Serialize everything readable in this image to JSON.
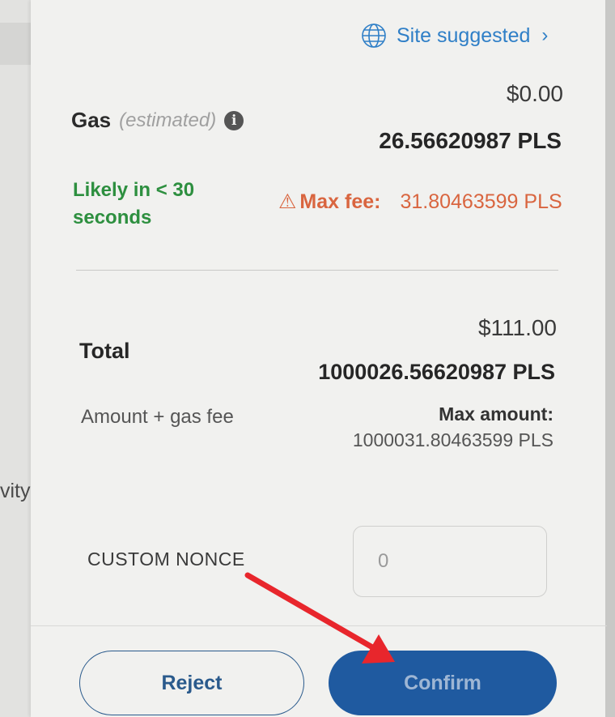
{
  "sidebar": {
    "partial_text": "vity"
  },
  "site_suggested": {
    "label": "Site suggested",
    "icon": "globe-icon",
    "chevron": "›"
  },
  "gas": {
    "title": "Gas",
    "estimated": "(estimated)",
    "info_icon": "i",
    "usd": "$0.00",
    "pls": "26.56620987 PLS",
    "likely": "Likely in < 30 seconds",
    "max_fee_warning_icon": "⚠",
    "max_fee_label": "Max fee:",
    "max_fee_value": "31.80463599 PLS"
  },
  "total": {
    "title": "Total",
    "usd": "$111.00",
    "pls": "1000026.56620987 PLS",
    "subtitle": "Amount + gas fee",
    "max_amount_label": "Max amount:",
    "max_amount_value": "1000031.80463599 PLS"
  },
  "nonce": {
    "label": "CUSTOM NONCE",
    "placeholder": "0"
  },
  "actions": {
    "reject": "Reject",
    "confirm": "Confirm"
  },
  "colors": {
    "link_blue": "#2f7fc7",
    "success_green": "#2d8f3f",
    "warning_orange": "#d9653f",
    "primary_blue": "#1f5aa0",
    "annotation_red": "#e8262c"
  }
}
